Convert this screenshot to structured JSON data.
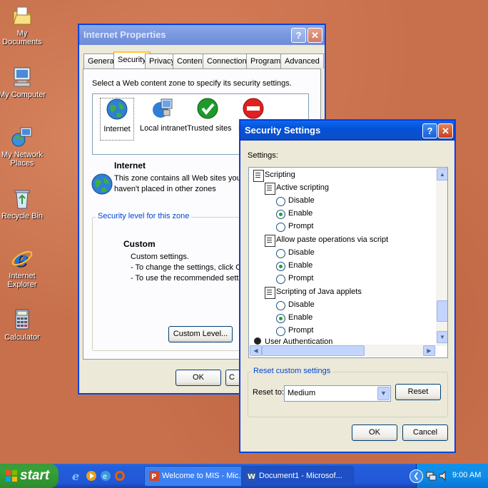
{
  "desktop_icons": [
    {
      "label": "My Documents",
      "icon": "my-documents-icon"
    },
    {
      "label": "My Computer",
      "icon": "my-computer-icon"
    },
    {
      "label": "My Network Places",
      "icon": "my-network-places-icon"
    },
    {
      "label": "Recycle Bin",
      "icon": "recycle-bin-icon"
    },
    {
      "label": "Internet Explorer",
      "icon": "internet-explorer-icon"
    },
    {
      "label": "Calculator",
      "icon": "calculator-icon"
    }
  ],
  "internet_properties": {
    "title": "Internet Properties",
    "tabs": [
      "General",
      "Security",
      "Privacy",
      "Content",
      "Connections",
      "Programs",
      "Advanced"
    ],
    "active_tab": "Security",
    "instruction": "Select a Web content zone to specify its security settings.",
    "zones": [
      "Internet",
      "Local intranet",
      "Trusted sites",
      "R"
    ],
    "zone_title": "Internet",
    "zone_desc_1": "This zone contains all Web sites you",
    "zone_desc_2": "haven't placed in other zones",
    "level_group": "Security level for this zone",
    "level_name": "Custom",
    "level_line_1": "Custom settings.",
    "level_line_2": "- To change the settings, click Custom",
    "level_line_3": "- To use the recommended settings, c",
    "custom_level_button": "Custom Level...",
    "ok_button": "OK",
    "cancel_button": "C"
  },
  "security_settings": {
    "title": "Security Settings",
    "settings_label": "Settings:",
    "tree": {
      "category": "Scripting",
      "groups": [
        {
          "name": "Active scripting",
          "options": [
            "Disable",
            "Enable",
            "Prompt"
          ],
          "selected": "Enable"
        },
        {
          "name": "Allow paste operations via script",
          "options": [
            "Disable",
            "Enable",
            "Prompt"
          ],
          "selected": "Enable"
        },
        {
          "name": "Scripting of Java applets",
          "options": [
            "Disable",
            "Enable",
            "Prompt"
          ],
          "selected": "Enable"
        }
      ],
      "next_category": "User Authentication"
    },
    "reset_group": "Reset custom settings",
    "reset_to_label": "Reset to:",
    "reset_to_value": "Medium",
    "reset_button": "Reset",
    "ok_button": "OK",
    "cancel_button": "Cancel"
  },
  "taskbar": {
    "start": "start",
    "items": [
      "Welcome to MIS - Mic...",
      "Document1 - Microsof..."
    ],
    "clock": "9:00 AM"
  },
  "colors": {
    "desktop": "#c8704c",
    "titlebar": "#0451d6",
    "window": "#ece9d8",
    "taskbar": "#245edb",
    "start": "#37a137"
  }
}
